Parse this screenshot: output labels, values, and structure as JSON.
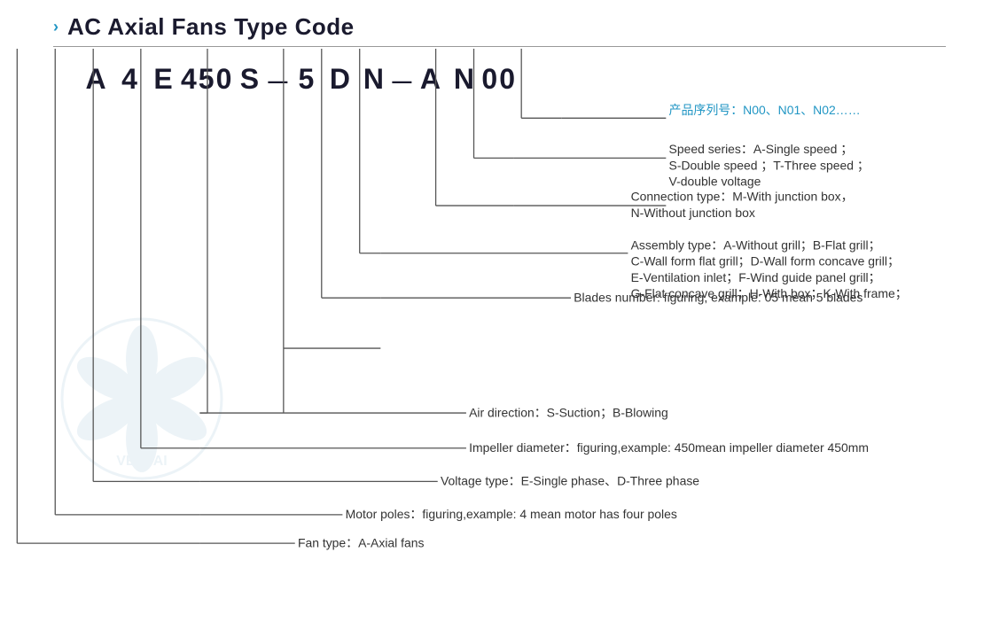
{
  "title": "AC Axial Fans Type Code",
  "chevron": "›",
  "type_code": {
    "chars": [
      "A",
      "4",
      "E",
      "450",
      "S",
      "—",
      "5",
      "D",
      "N",
      "—",
      "A",
      "N",
      "00"
    ]
  },
  "descriptions": {
    "product_series": {
      "cn": "产品序列号：N00、N01、N02……",
      "label": ""
    },
    "speed_series": {
      "line1": "Speed series：A-Single speed ；",
      "line2": "S-Double speed ；T-Three speed ；",
      "line3": "V-double voltage"
    },
    "connection_type": {
      "line1": "Connection type：M-With junction box，",
      "line2": "N-Without junction box"
    },
    "assembly_type": {
      "line1": "Assembly type：A-Without grill；B-Flat grill；",
      "line2": "C-Wall form flat grill；D-Wall form concave grill；",
      "line3": "E-Ventilation inlet；F-Wind guide panel grill；",
      "line4": "G-Flat concave grill；H-With box；K-With frame；"
    },
    "blades_number": {
      "label": "Blades number: figuring, example: 05 mean 5 blades"
    },
    "air_direction": {
      "label": "Air direction：S-Suction；B-Blowing"
    },
    "impeller_diameter": {
      "label": "Impeller diameter：figuring,example: 450mean impeller diameter 450mm"
    },
    "voltage_type": {
      "label": "Voltage type：E-Single phase、D-Three phase"
    },
    "motor_poles": {
      "label": "Motor poles：figuring,example: 4 mean motor has four poles"
    },
    "fan_type": {
      "label": "Fan type：A-Axial fans"
    }
  },
  "brand": "VENTAI",
  "colors": {
    "accent": "#2196c4",
    "dark": "#1a1a2e",
    "line": "#555",
    "text": "#333"
  }
}
